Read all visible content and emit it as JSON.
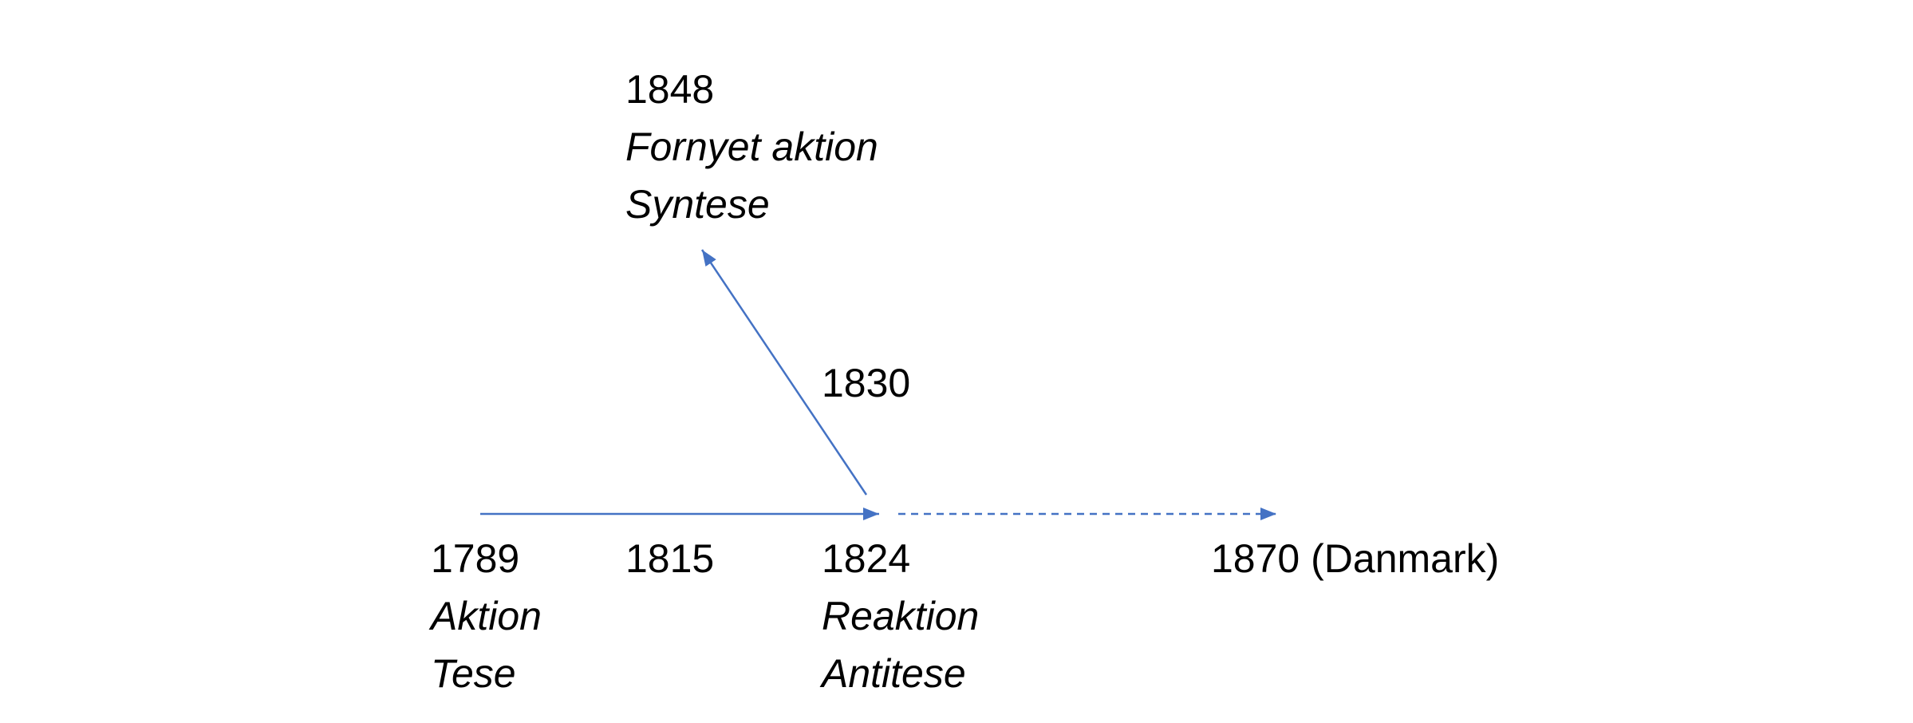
{
  "colors": {
    "arrow": "#4472C4",
    "text": "#000000",
    "background": "#ffffff"
  },
  "nodes": {
    "n1789": {
      "year": "1789",
      "line1": "Aktion",
      "line2": "Tese"
    },
    "n1815": {
      "year": "1815"
    },
    "n1824": {
      "year": "1824",
      "line1": "Reaktion",
      "line2": "Antitese"
    },
    "n1830": {
      "year": "1830"
    },
    "n1848": {
      "year": "1848",
      "line1": "Fornyet aktion",
      "line2": "Syntese"
    },
    "n1870": {
      "year": "1870 (Danmark)"
    }
  },
  "arrows": [
    {
      "name": "timeline-arrow-1789-1824",
      "from": "1789",
      "to": "1824",
      "style": "solid"
    },
    {
      "name": "timeline-arrow-1824-1870",
      "from": "1824",
      "to": "1870",
      "style": "dashed"
    },
    {
      "name": "arrow-1824-1848",
      "from": "1824",
      "to": "1848",
      "style": "solid"
    }
  ]
}
